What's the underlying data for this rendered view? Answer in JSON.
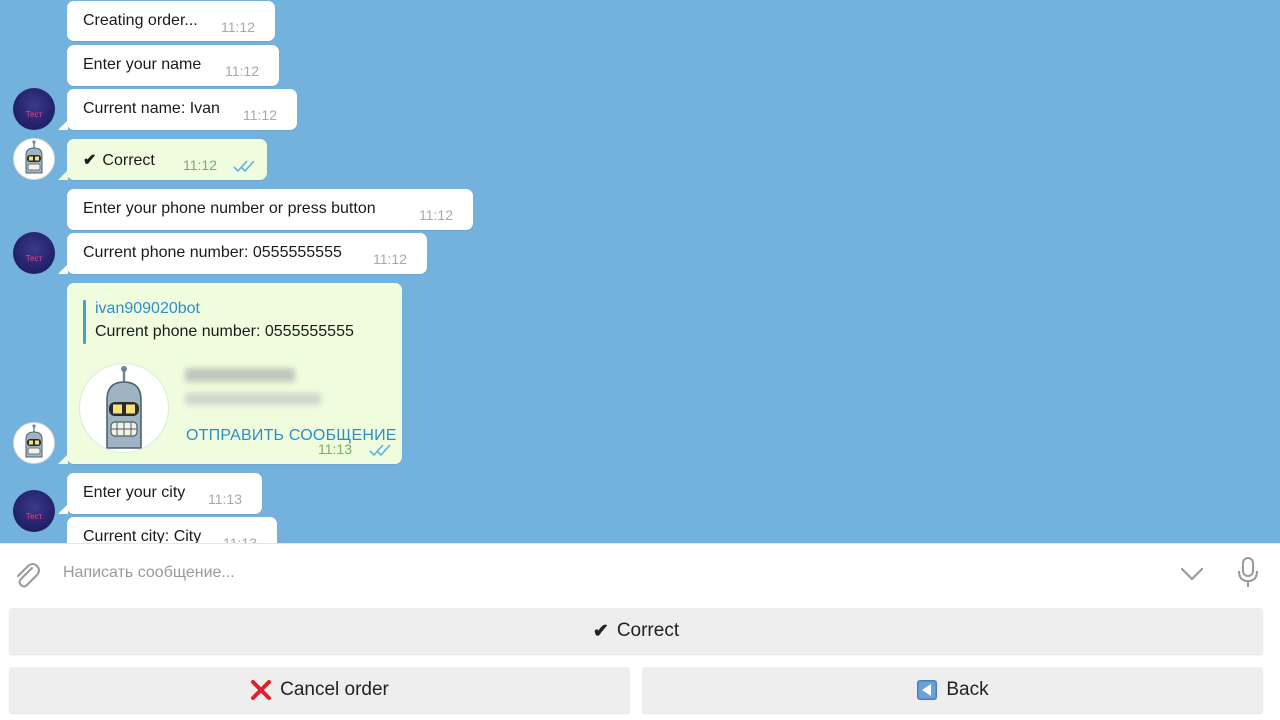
{
  "messages": [
    {
      "text": "Creating order...",
      "time": "11:12"
    },
    {
      "text": "Enter your name",
      "time": "11:12"
    },
    {
      "text": "Current name: Ivan",
      "time": "11:12"
    },
    {
      "text": "Correct",
      "time": "11:12"
    },
    {
      "text": "Enter your phone number or press button",
      "time": "11:12"
    },
    {
      "text": "Current phone number: 0555555555",
      "time": "11:12"
    },
    {
      "text": "Enter your city",
      "time": "11:13"
    },
    {
      "text": "Current city: City",
      "time": "11:13"
    }
  ],
  "avatars": {
    "bot_label": "Тест"
  },
  "contact_message": {
    "reply_name": "ivan909020bot",
    "reply_text": "Current phone number: 0555555555",
    "send_message_label": "ОТПРАВИТЬ СООБЩЕНИЕ",
    "time": "11:13"
  },
  "input": {
    "placeholder": "Написать сообщение..."
  },
  "keyboard": {
    "correct_label": "Correct",
    "cancel_label": "Cancel order",
    "back_label": "Back"
  },
  "colors": {
    "chat_bg": "#74b2de",
    "link": "#2f8ec4",
    "check": "#5fb3e0",
    "cancel": "#e0202a"
  },
  "icons": [
    "attach-icon",
    "chevron-down-icon",
    "microphone-icon",
    "double-check-icon",
    "check-mark-icon",
    "cross-icon",
    "back-arrow-icon"
  ]
}
